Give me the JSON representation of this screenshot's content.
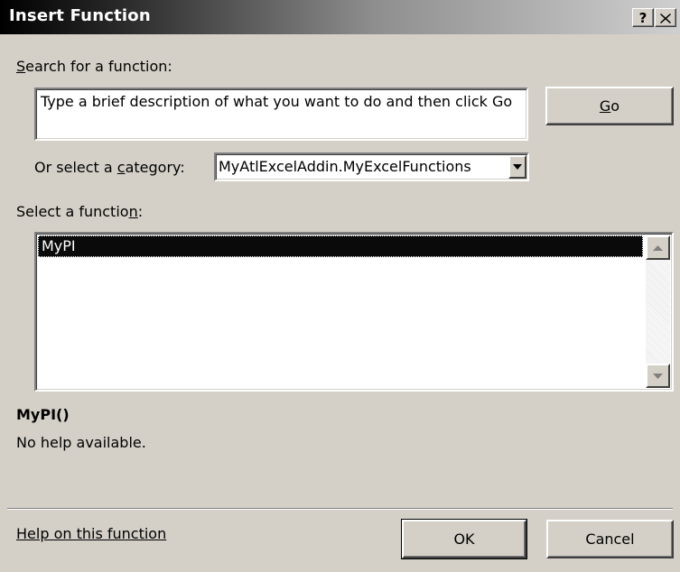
{
  "window": {
    "title": "Insert Function",
    "help_button": "?",
    "close_button": "X"
  },
  "search": {
    "label_prefix": "",
    "label_access_key": "S",
    "label_rest": "earch for a function:",
    "value": "Type a brief description of what you want to do and then click Go",
    "go_button": {
      "access_key": "G",
      "rest": "o"
    }
  },
  "category": {
    "label_prefix": "Or select a ",
    "label_access_key": "c",
    "label_rest": "ategory:",
    "selected": "MyAtlExcelAddin.MyExcelFunctions"
  },
  "functions": {
    "label_prefix": "Select a functio",
    "label_access_key": "n",
    "label_rest": ":",
    "items": [
      "MyPI"
    ],
    "selected_index": 0
  },
  "details": {
    "signature": "MyPI()",
    "description": "No help available."
  },
  "footer": {
    "help_link": "Help on this function",
    "ok_button": "OK",
    "cancel_button": "Cancel"
  },
  "icons": {
    "combo_arrow": "chevron-down-icon",
    "scroll_up": "scroll-up-arrow-icon",
    "scroll_down": "scroll-down-arrow-icon"
  }
}
